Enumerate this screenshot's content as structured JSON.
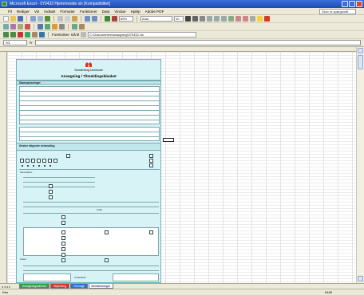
{
  "window": {
    "title": "Microsoft Excel - 070432 Hjemmeside.xls [Kompatibilitet]"
  },
  "menu": {
    "items": [
      "Fil",
      "Rediger",
      "Vis",
      "Indsæt",
      "Formater",
      "Funktioner",
      "Data",
      "Vindue",
      "Hjælp",
      "Adobe PDF"
    ],
    "help_placeholder": "Skriv et spørgsmål"
  },
  "toolbar": {
    "zoom": "85%",
    "font": "Arial",
    "size": "10"
  },
  "webbar": {
    "favorites_label": "Foretrukne",
    "goto_label": "Gå til",
    "address": "C:\\Dokumenter\\Ansøgning\\070432.xls"
  },
  "formula": {
    "cell_ref": "A1",
    "fx": "fx",
    "content": ""
  },
  "form": {
    "org": "Sonderborg kommune",
    "title": "Ansøgning / Tilmeldingsblanket",
    "section_data": "Stamoplysninger",
    "section_beh": "Ønsker følgende behandling",
    "vaccine_label": "Vaccination",
    "number_label": "Antal",
    "other_label": "Andet",
    "signature_label": "Underskrift"
  },
  "sheet_tabs": [
    "Ansøgningsskema",
    "Vejledning",
    "Oversigt",
    "Bemærkninger"
  ],
  "status": {
    "left": "Klar",
    "right": "NUM"
  },
  "colors": {
    "form_bg": "#d7f3f6",
    "tab1": "#2aa44a",
    "tab2": "#d9312b",
    "tab3": "#2f6fd1"
  }
}
